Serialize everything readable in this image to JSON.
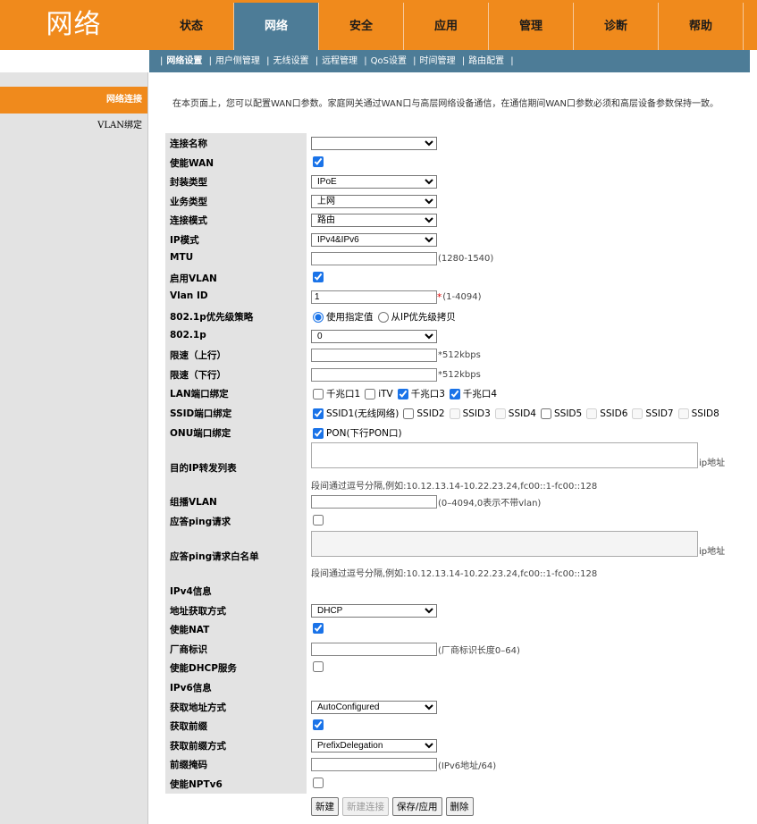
{
  "logo": "网络",
  "main_tabs": [
    {
      "label": "状态",
      "active": false
    },
    {
      "label": "网络",
      "active": true
    },
    {
      "label": "安全",
      "active": false
    },
    {
      "label": "应用",
      "active": false
    },
    {
      "label": "管理",
      "active": false
    },
    {
      "label": "诊断",
      "active": false
    },
    {
      "label": "帮助",
      "active": false
    }
  ],
  "sub_tabs": [
    "网络设置",
    "用户侧管理",
    "无线设置",
    "远程管理",
    "QoS设置",
    "时间管理",
    "路由配置"
  ],
  "sidebar": [
    "网络连接",
    "VLAN绑定"
  ],
  "intro": "在本页面上，您可以配置WAN口参数。家庭网关通过WAN口与高层网络设备通信，在通信期间WAN口参数必须和高层设备参数保持一致。",
  "form": {
    "conn_name": {
      "label": "连接名称",
      "value": ""
    },
    "enable_wan": {
      "label": "使能WAN"
    },
    "encap": {
      "label": "封装类型",
      "value": "IPoE"
    },
    "service": {
      "label": "业务类型",
      "value": "上网"
    },
    "conn_mode": {
      "label": "连接模式",
      "value": "路由"
    },
    "ip_mode": {
      "label": "IP模式",
      "value": "IPv4&IPv6"
    },
    "mtu": {
      "label": "MTU",
      "hint": "(1280-1540)"
    },
    "enable_vlan": {
      "label": "启用VLAN"
    },
    "vlan_id": {
      "label": "Vlan ID",
      "value": "1",
      "req": "*",
      "hint": "(1-4094)"
    },
    "p8021_policy": {
      "label": "802.1p优先级策略",
      "opt1": "使用指定值",
      "opt2": "从IP优先级拷贝"
    },
    "p8021": {
      "label": "802.1p",
      "value": "0"
    },
    "rate_up": {
      "label": "限速（上行）",
      "hint": "*512kbps"
    },
    "rate_down": {
      "label": "限速（下行）",
      "hint": "*512kbps"
    },
    "lan_bind": {
      "label": "LAN端口绑定",
      "items": [
        "千兆口1",
        "iTV",
        "千兆口3",
        "千兆口4"
      ]
    },
    "ssid_bind": {
      "label": "SSID端口绑定",
      "items": [
        "SSID1(无线网络)",
        "SSID2",
        "SSID3",
        "SSID4",
        "SSID5",
        "SSID6",
        "SSID7",
        "SSID8"
      ]
    },
    "onu_bind": {
      "label": "ONU端口绑定",
      "item": "PON(下行PON口)"
    },
    "dest_ip": {
      "label": "目的IP转发列表",
      "hint": "ip地址",
      "note": "段间通过逗号分隔,例如:10.12.13.14-10.22.23.24,fc00::1-fc00::128"
    },
    "mcast_vlan": {
      "label": "组播VLAN",
      "hint": "(0–4094,0表示不带vlan)"
    },
    "ping_reply": {
      "label": "应答ping请求"
    },
    "ping_white": {
      "label": "应答ping请求白名单",
      "hint": "ip地址",
      "note": "段间通过逗号分隔,例如:10.12.13.14-10.22.23.24,fc00::1-fc00::128"
    },
    "ipv4_info": {
      "label": "IPv4信息"
    },
    "addr_mode": {
      "label": "地址获取方式",
      "value": "DHCP"
    },
    "enable_nat": {
      "label": "使能NAT"
    },
    "vendor": {
      "label": "厂商标识",
      "hint": "(厂商标识长度0–64)"
    },
    "dhcp_server": {
      "label": "使能DHCP服务"
    },
    "ipv6_info": {
      "label": "IPv6信息"
    },
    "ipv6_addr_mode": {
      "label": "获取地址方式",
      "value": "AutoConfigured"
    },
    "get_prefix": {
      "label": "获取前缀"
    },
    "prefix_mode": {
      "label": "获取前缀方式",
      "value": "PrefixDelegation"
    },
    "prefix_mask": {
      "label": "前缀掩码",
      "hint": "(IPv6地址/64)"
    },
    "enable_nptv6": {
      "label": "使能NPTv6"
    }
  },
  "buttons": {
    "new": "新建",
    "new_conn": "新建连接",
    "save": "保存/应用",
    "delete": "删除"
  }
}
